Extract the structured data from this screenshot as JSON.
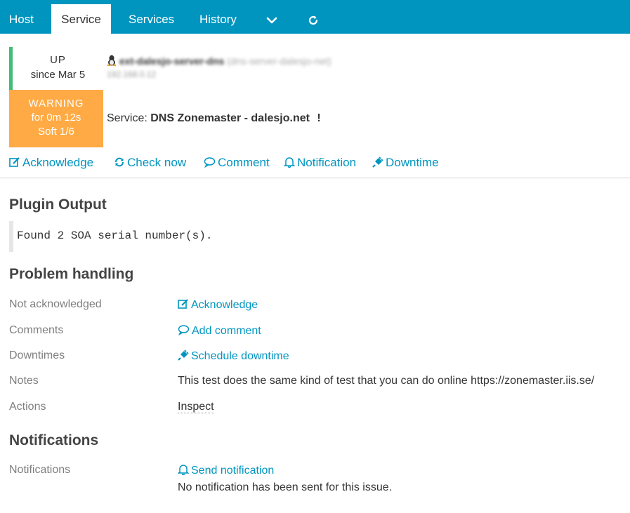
{
  "tabs": [
    "Host",
    "Service",
    "Services",
    "History"
  ],
  "tab_extra_icons": [
    "chevron-down-icon",
    "refresh-icon"
  ],
  "host": {
    "state": "UP",
    "since": "since Mar 5",
    "name_blurred": "ext-dalesjo-server-dns",
    "alias_blurred": "(dns-server-dalesjo-net)",
    "ip_blurred": "192.168.0.12"
  },
  "service": {
    "state": "WARNING",
    "duration": "for 0m 12s",
    "attempt": "Soft 1/6",
    "label": "Service:",
    "name": "DNS Zonemaster - dalesjo.net",
    "flag": "!"
  },
  "quick_actions": [
    "Acknowledge",
    "Check now",
    "Comment",
    "Notification",
    "Downtime"
  ],
  "plugin_output": {
    "title": "Plugin Output",
    "text": "Found 2 SOA serial number(s)."
  },
  "problem_handling": {
    "title": "Problem handling",
    "rows": [
      {
        "label": "Not acknowledged",
        "value": "Acknowledge"
      },
      {
        "label": "Comments",
        "value": "Add comment"
      },
      {
        "label": "Downtimes",
        "value": "Schedule downtime"
      },
      {
        "label": "Notes",
        "value": "This test does the same kind of test that you can do online https://zonemaster.iis.se/"
      },
      {
        "label": "Actions",
        "value": "Inspect"
      }
    ]
  },
  "notifications": {
    "title": "Notifications",
    "label": "Notifications",
    "link": "Send notification",
    "status": "No notification has been sent for this issue."
  },
  "colors": {
    "brand": "#0095bf",
    "up": "#44bb77",
    "warning": "#ffaa44"
  }
}
